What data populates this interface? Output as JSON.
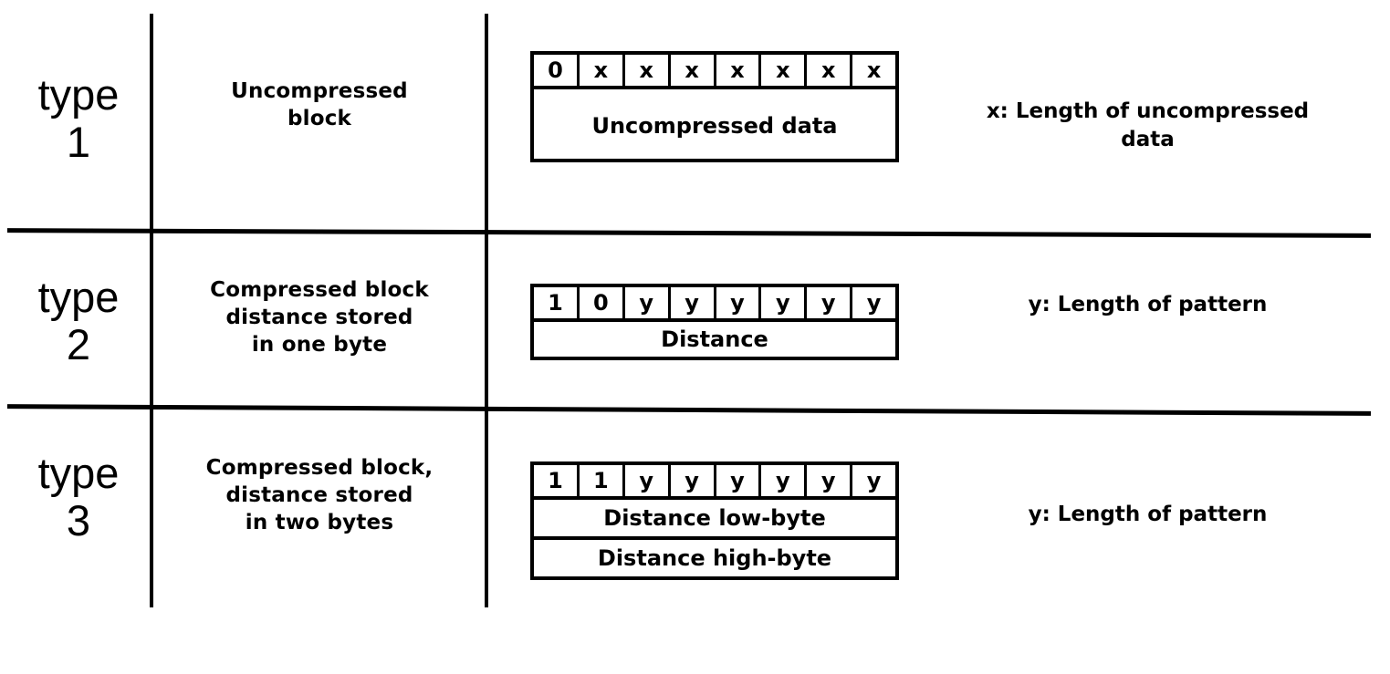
{
  "figure": {
    "kind": "block-format-table",
    "line_color": "#000000",
    "background": "#ffffff"
  },
  "rows": [
    {
      "type_label": "type",
      "type_number": "1",
      "description": "Uncompressed block",
      "description_lines": [
        "Uncompressed",
        "block"
      ],
      "bits": [
        "0",
        "x",
        "x",
        "x",
        "x",
        "x",
        "x",
        "x"
      ],
      "payload_boxes": [
        "Uncompressed data"
      ],
      "note": "x: Length of uncompressed data",
      "note_lines": [
        "x: Length of uncompressed",
        "data"
      ]
    },
    {
      "type_label": "type",
      "type_number": "2",
      "description": "Compressed block distance stored in one byte",
      "description_lines": [
        "Compressed block",
        "distance stored",
        "in one byte"
      ],
      "bits": [
        "1",
        "0",
        "y",
        "y",
        "y",
        "y",
        "y",
        "y"
      ],
      "payload_boxes": [
        "Distance"
      ],
      "note": "y: Length of pattern",
      "note_lines": [
        "y: Length of pattern"
      ]
    },
    {
      "type_label": "type",
      "type_number": "3",
      "description": "Compressed block, distance stored in two bytes",
      "description_lines": [
        "Compressed block,",
        "distance stored",
        "in two bytes"
      ],
      "bits": [
        "1",
        "1",
        "y",
        "y",
        "y",
        "y",
        "y",
        "y"
      ],
      "payload_boxes": [
        "Distance low-byte",
        "Distance high-byte"
      ],
      "note": "y: Length of pattern",
      "note_lines": [
        "y: Length of pattern"
      ]
    }
  ]
}
